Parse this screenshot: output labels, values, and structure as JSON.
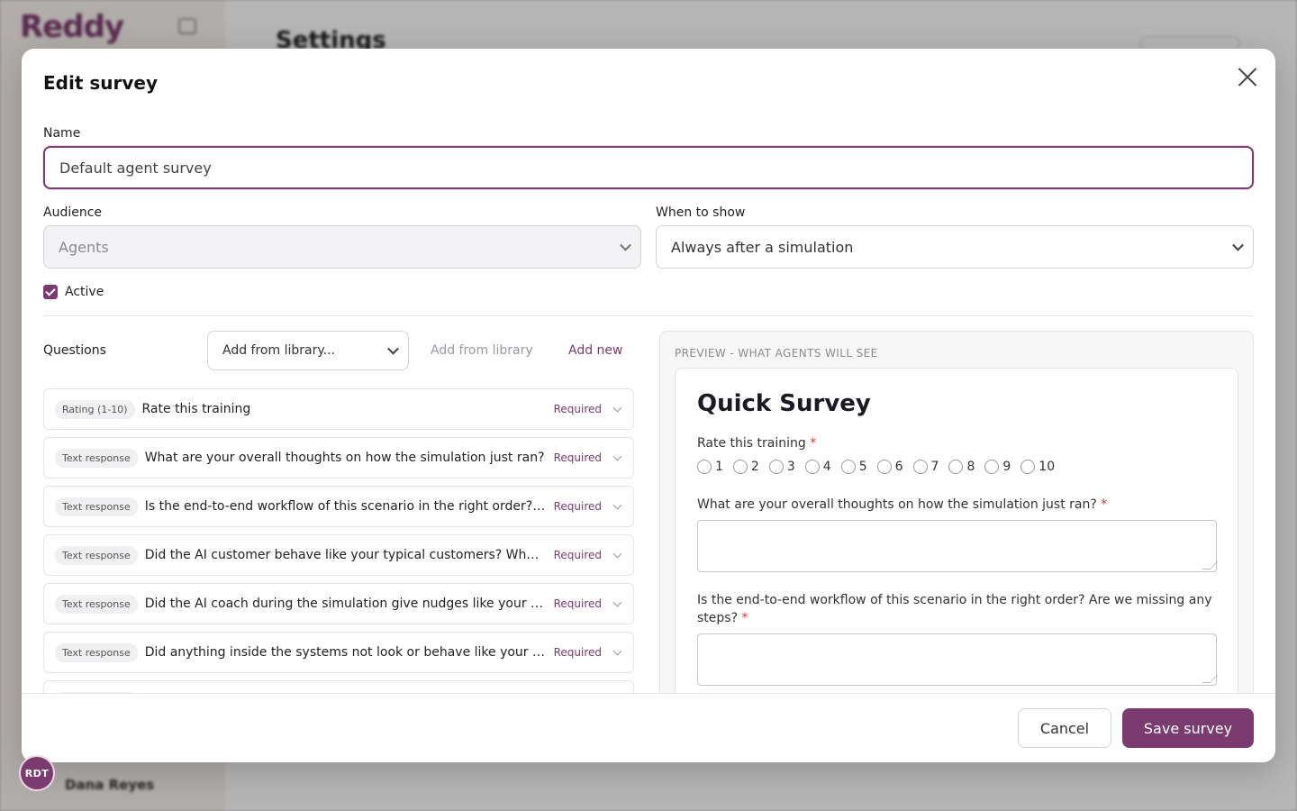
{
  "background": {
    "logo": "Reddy",
    "page_title": "Settings",
    "user_name": "Dana Reyes",
    "avatar_initials": "RDT"
  },
  "modal": {
    "title": "Edit survey",
    "name_label": "Name",
    "name_value": "Default agent survey",
    "audience_label": "Audience",
    "audience_value": "Agents",
    "when_label": "When to show",
    "when_value": "Always after a simulation",
    "active_label": "Active",
    "active_checked": true,
    "questions_label": "Questions",
    "library_select_placeholder": "Add from library...",
    "add_from_library_label": "Add from library",
    "add_new_label": "Add new",
    "questions": [
      {
        "type": "Rating (1-10)",
        "text": "Rate this training",
        "required": "Required"
      },
      {
        "type": "Text response",
        "text": "What are your overall thoughts on how the simulation just ran?",
        "required": "Required"
      },
      {
        "type": "Text response",
        "text": "Is the end-to-end workflow of this scenario in the right order? Are we missing any steps?",
        "required": "Required"
      },
      {
        "type": "Text response",
        "text": "Did the AI customer behave like your typical customers? What would you change?",
        "required": "Required"
      },
      {
        "type": "Text response",
        "text": "Did the AI coach during the simulation give nudges like your manager would?",
        "required": "Required"
      },
      {
        "type": "Text response",
        "text": "Did anything inside the systems not look or behave like your real tools?",
        "required": "Required"
      },
      {
        "type": "Text response",
        "text": "",
        "required": ""
      }
    ],
    "preview": {
      "label": "PREVIEW - WHAT AGENTS WILL SEE",
      "survey_title": "Quick Survey",
      "q1": "Rate this training",
      "rating_options": [
        "1",
        "2",
        "3",
        "4",
        "5",
        "6",
        "7",
        "8",
        "9",
        "10"
      ],
      "q2": "What are your overall thoughts on how the simulation just ran?",
      "q3": "Is the end-to-end workflow of this scenario in the right order? Are we missing any steps?",
      "required_mark": "*"
    },
    "cancel_label": "Cancel",
    "save_label": "Save survey"
  },
  "colors": {
    "accent": "#7b3b6e",
    "required_star": "#dd3333"
  }
}
